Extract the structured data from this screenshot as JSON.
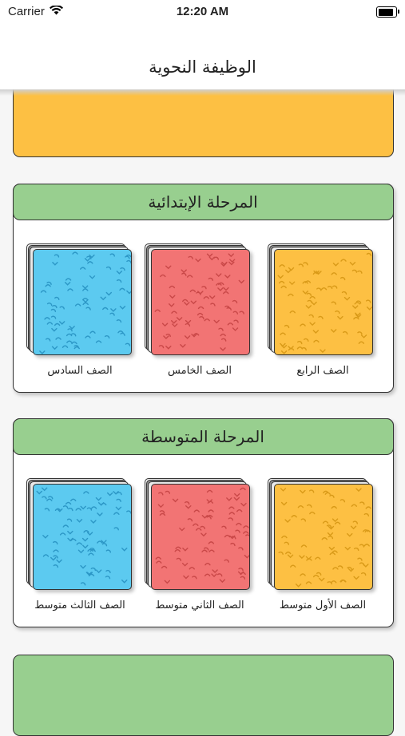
{
  "status_bar": {
    "carrier": "Carrier",
    "time": "12:20 AM",
    "battery_level": 0.9
  },
  "nav": {
    "title": "الوظيفة النحوية"
  },
  "sections": [
    {
      "title": "المرحلة الإبتدائية",
      "grades": [
        {
          "label": "الصف الرابع",
          "color": "#fdc043",
          "pattern_color": "#d99a18"
        },
        {
          "label": "الصف الخامس",
          "color": "#f27474",
          "pattern_color": "#c94848"
        },
        {
          "label": "الصف السادس",
          "color": "#5ccaf0",
          "pattern_color": "#2c97c6"
        }
      ]
    },
    {
      "title": "المرحلة المتوسطة",
      "grades": [
        {
          "label": "الصف الأول متوسط",
          "color": "#fdc043",
          "pattern_color": "#d99a18"
        },
        {
          "label": "الصف الثاني متوسط",
          "color": "#f27474",
          "pattern_color": "#c94848"
        },
        {
          "label": "الصف الثالث متوسط",
          "color": "#5ccaf0",
          "pattern_color": "#2c97c6"
        }
      ]
    }
  ],
  "colors": {
    "yellow_card": "#fdc043",
    "green_header": "#98cf8f"
  }
}
